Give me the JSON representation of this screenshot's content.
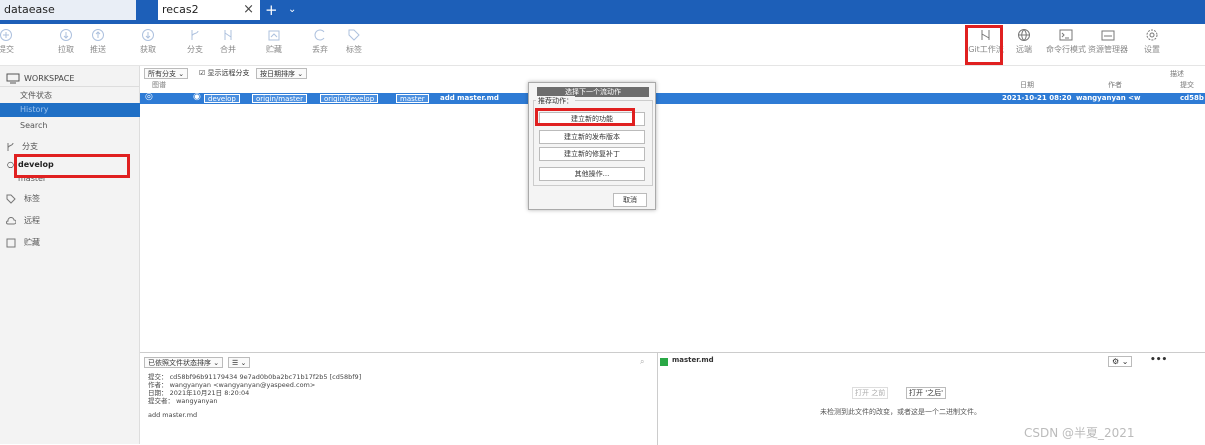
{
  "tabs": [
    {
      "label": "dataease"
    },
    {
      "label": "recas2",
      "close": "×"
    }
  ],
  "tab_add": "+",
  "tab_menu": "⌄",
  "toolbar": {
    "left": [
      "提交",
      "拉取",
      "推送",
      "获取",
      "分支",
      "合并",
      "贮藏",
      "丢弃",
      "标签"
    ],
    "right": [
      "Git工作流",
      "远端",
      "命令行模式",
      "资源管理器",
      "设置"
    ]
  },
  "sidebar": {
    "workspace": "WORKSPACE",
    "items": [
      "文件状态",
      "History",
      "Search"
    ],
    "branches_header": "分支",
    "branches": [
      "develop",
      "master"
    ],
    "tags": "标签",
    "remotes": "远程",
    "stashes": "贮藏"
  },
  "filters": {
    "branch_filter": "所有分支",
    "remote_toggle": "显示远程分支",
    "order": "按日期排序"
  },
  "columns": {
    "graph": "图谱",
    "date": "日期",
    "author": "作者",
    "commit": "提交",
    "desc": "描述"
  },
  "commit_row": {
    "tags": [
      "develop",
      "origin/master",
      "origin/develop",
      "master"
    ],
    "message": "add master.md",
    "date": "2021-10-21 08:20",
    "author": "wangyanyan <w",
    "hash": "cd58b"
  },
  "dialog": {
    "title": "选择下一个流动作",
    "group": "推荐动作：",
    "buttons": [
      "建立新的功能",
      "建立新的发布版本",
      "建立新的修复补丁",
      "其他操作..."
    ],
    "cancel": "取消"
  },
  "bottom": {
    "sort": "已依照文件状态排序",
    "view": "☰",
    "commit_lines": [
      "提交： cd58bf96b91179434 9e7ad0b0ba2bc71b17f2b5 [cd58bf9]",
      "作者： wangyanyan <wangyanyan@yaspeed.com>",
      "日期： 2021年10月21日 8:20:04",
      "提交者： wangyanyan"
    ],
    "message": "add master.md",
    "file": "master.md",
    "open_prev": "打开 之前",
    "open_after": "打开 '之后'",
    "note": "未检测到此文件的改变，或者这是一个二进制文件。"
  },
  "watermark": "CSDN @半夏_2021",
  "colors": {
    "tabbar": "#1d5fb8",
    "selection": "#2e7bd5",
    "highlight": "#e02020"
  }
}
